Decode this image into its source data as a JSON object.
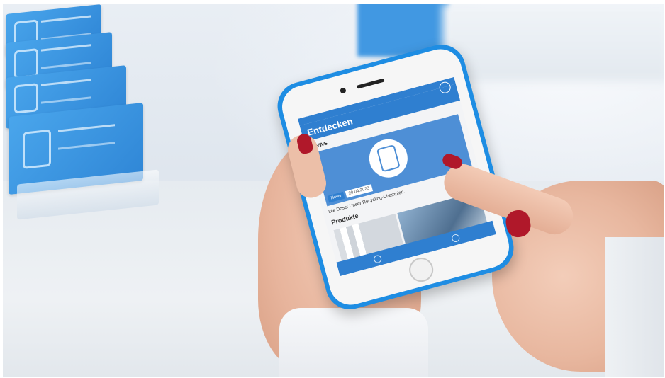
{
  "app": {
    "header_title": "Entdecken",
    "sections": {
      "news_title": "News",
      "news_badge": "News",
      "news_date": "20.04.2023",
      "news_headline": "Die Dose: Unser Recycling-Champion.",
      "products_title": "Produkte"
    }
  },
  "colors": {
    "phone_case": "#1e8de3",
    "app_primary": "#2f7fd0",
    "nail_polish": "#b0182a"
  },
  "icons": [
    "profile-icon",
    "can-icon",
    "tab-discover-icon",
    "tab-settings-icon"
  ]
}
